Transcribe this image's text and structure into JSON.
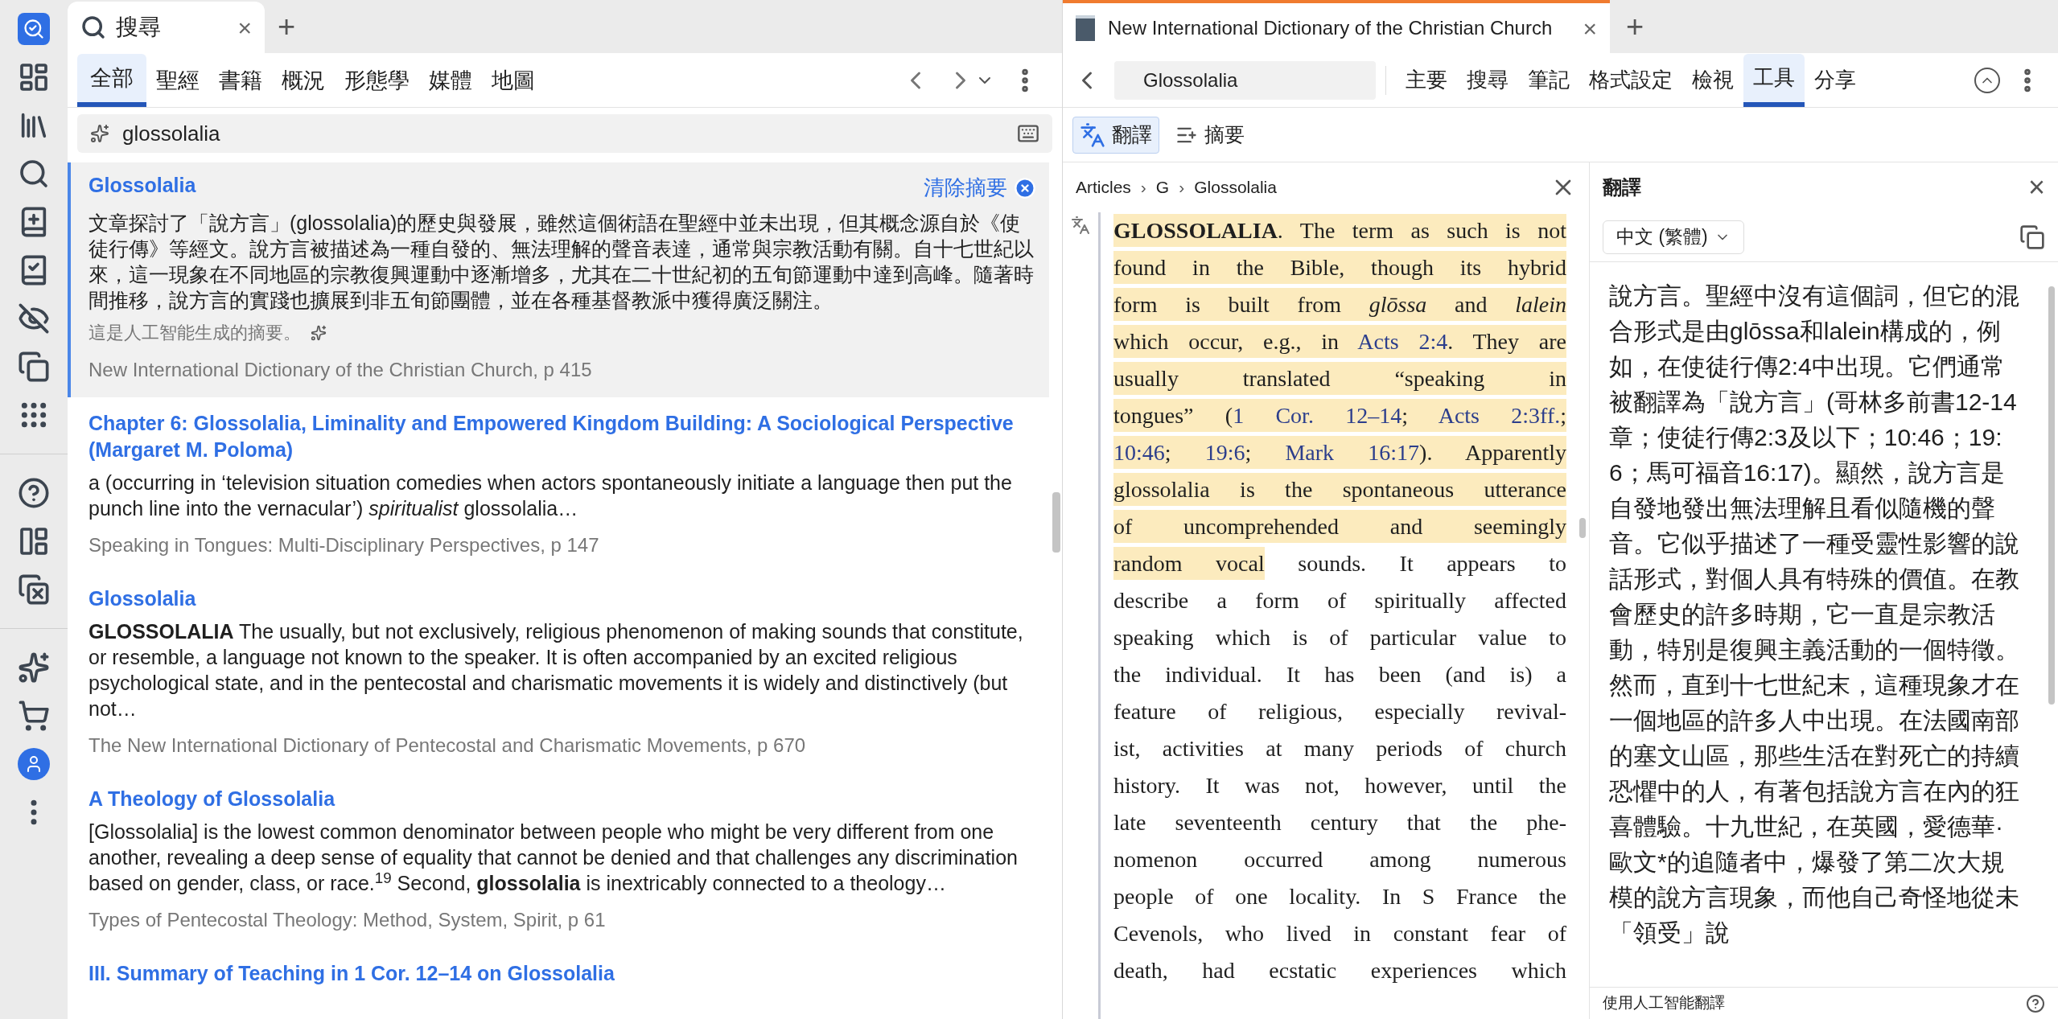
{
  "left_tab": {
    "title": "搜尋",
    "close": "×",
    "add": "+"
  },
  "search_tabs": [
    {
      "label": "全部",
      "selected": true
    },
    {
      "label": "聖經",
      "selected": false
    },
    {
      "label": "書籍",
      "selected": false
    },
    {
      "label": "概況",
      "selected": false
    },
    {
      "label": "形態學",
      "selected": false
    },
    {
      "label": "媒體",
      "selected": false
    },
    {
      "label": "地圖",
      "selected": false
    }
  ],
  "search": {
    "value": "glossolalia"
  },
  "results": [
    {
      "title": "Glossolalia",
      "selected": true,
      "clear_label": "清除摘要",
      "snippet": "文章探討了「說方言」(glossolalia)的歷史與發展，雖然這個術語在聖經中並未出現，但其概念源自於《使徒行傳》等經文。說方言被描述為一種自發的、無法理解的聲音表達，通常與宗教活動有關。自十七世紀以來，這一現象在不同地區的宗教復興運動中逐漸增多，尤其在二十世紀初的五旬節運動中達到高峰。隨著時間推移，說方言的實踐也擴展到非五旬節團體，並在各種基督教派中獲得廣泛關注。",
      "ai_note": "這是人工智能生成的摘要。",
      "source": "New International Dictionary of the Christian Church, p 415"
    },
    {
      "title": "Chapter 6: Glossolalia, Liminality and Empowered Kingdom Building: A Sociological Perspective (Margaret M. Poloma)",
      "selected": false,
      "snippet": "a (occurring in ‘television situation comedies when actors spontaneously initiate a language then put the punch line into the vernacular’) *spiritualist* glossolalia…",
      "source": "Speaking in Tongues: Multi-Disciplinary Perspectives, p 147"
    },
    {
      "title": "Glossolalia",
      "selected": false,
      "snippet": "**GLOSSOLALIA** The usually, but not exclusively, religious phenomenon of making sounds that constitute, or resemble, a language not known to the speaker. It is often accompanied by an excited religious psychological state, and in the pentecostal and charismatic movements it is widely and distinctively (but not…",
      "source": "The New International Dictionary of Pentecostal and Charismatic Movements, p 670"
    },
    {
      "title": "A Theology of Glossolalia",
      "selected": false,
      "snippet": "[Glossolalia] is the lowest common denominator between people who might be very different from one another, revealing a deep sense of equality that cannot be denied and that challenges any discrimination based on gender, class, or race.$^{19}$ Second, **glossolalia** is inextricably connected to a theology…",
      "source": "Types of Pentecostal Theology: Method, System, Spirit, p 61"
    },
    {
      "title": "III. Summary of Teaching in 1 Cor. 12–14 on Glossolalia",
      "selected": false
    }
  ],
  "right_tab": {
    "title": "New International Dictionary of the Christian Church",
    "close": "×",
    "add": "+"
  },
  "reference": {
    "value": "Glossolalia"
  },
  "menu": [
    {
      "label": "主要",
      "selected": false
    },
    {
      "label": "搜尋",
      "selected": false
    },
    {
      "label": "筆記",
      "selected": false
    },
    {
      "label": "格式設定",
      "selected": false
    },
    {
      "label": "檢視",
      "selected": false
    },
    {
      "label": "工具",
      "selected": true
    },
    {
      "label": "分享",
      "selected": false
    }
  ],
  "tools": [
    {
      "label": "翻譯",
      "kind": "translate",
      "selected": true
    },
    {
      "label": "摘要",
      "kind": "summary",
      "selected": false
    }
  ],
  "breadcrumb": {
    "separator": "›",
    "items": [
      "Articles",
      "G",
      "Glossolalia"
    ]
  },
  "article": {
    "lines": [
      {
        "segments": [
          {
            "kind": "bold",
            "text": "GLOSSOLALIA",
            "highlighted": true
          },
          {
            "kind": "text",
            "text": ". The term as such is not",
            "highlighted": true
          }
        ]
      },
      {
        "segments": [
          {
            "kind": "text",
            "text": "found in the Bible, though its hybrid",
            "highlighted": true
          }
        ]
      },
      {
        "segments": [
          {
            "kind": "text",
            "text": "form is built from ",
            "highlighted": true
          },
          {
            "kind": "italic",
            "text": "glōssa",
            "highlighted": true
          },
          {
            "kind": "text",
            "text": " and ",
            "highlighted": true
          },
          {
            "kind": "italic",
            "text": "lalein",
            "highlighted": true
          }
        ]
      },
      {
        "segments": [
          {
            "kind": "text",
            "text": "which occur, e.g., in ",
            "highlighted": true
          },
          {
            "kind": "link",
            "text": "Acts 2:4",
            "highlighted": true
          },
          {
            "kind": "text",
            "text": ". They are",
            "highlighted": true
          }
        ]
      },
      {
        "segments": [
          {
            "kind": "text",
            "text": "usually translated “speaking in",
            "highlighted": true
          }
        ]
      },
      {
        "segments": [
          {
            "kind": "text",
            "text": "tongues” (",
            "highlighted": true
          },
          {
            "kind": "link",
            "text": "1 Cor. 12–14",
            "highlighted": true
          },
          {
            "kind": "text",
            "text": "; ",
            "highlighted": true
          },
          {
            "kind": "link",
            "text": "Acts 2:3ff.",
            "highlighted": true
          },
          {
            "kind": "text",
            "text": ";",
            "highlighted": true
          }
        ]
      },
      {
        "segments": [
          {
            "kind": "link",
            "text": "10:46",
            "highlighted": true
          },
          {
            "kind": "text",
            "text": "; ",
            "highlighted": true
          },
          {
            "kind": "link",
            "text": "19:6",
            "highlighted": true
          },
          {
            "kind": "text",
            "text": "; ",
            "highlighted": true
          },
          {
            "kind": "link",
            "text": "Mark 16:17",
            "highlighted": true
          },
          {
            "kind": "text",
            "text": "). Apparently",
            "highlighted": true
          }
        ]
      },
      {
        "segments": [
          {
            "kind": "text",
            "text": "glossolalia is the spontaneous utterance",
            "highlighted": true
          }
        ]
      },
      {
        "segments": [
          {
            "kind": "text",
            "text": "of uncomprehended and seemingly",
            "highlighted": true
          }
        ]
      },
      {
        "segments": [
          {
            "kind": "text",
            "text": "random vocal",
            "highlighted": true
          },
          {
            "kind": "text",
            "text": " sounds. It appears to",
            "highlighted": false
          }
        ]
      },
      {
        "segments": [
          {
            "kind": "text",
            "text": "describe a form of spiritually affected",
            "highlighted": false
          }
        ]
      },
      {
        "segments": [
          {
            "kind": "text",
            "text": "speaking which is of particular value to",
            "highlighted": false
          }
        ]
      },
      {
        "segments": [
          {
            "kind": "text",
            "text": "the individual. It has been (and is) a",
            "highlighted": false
          }
        ]
      },
      {
        "segments": [
          {
            "kind": "text",
            "text": "feature of religious, especially revival-",
            "highlighted": false
          }
        ]
      },
      {
        "segments": [
          {
            "kind": "text",
            "text": "ist, activities at many periods of church",
            "highlighted": false
          }
        ]
      },
      {
        "segments": [
          {
            "kind": "text",
            "text": "history. It was not, however, until the",
            "highlighted": false
          }
        ]
      },
      {
        "segments": [
          {
            "kind": "text",
            "text": "late seventeenth century that the phe-",
            "highlighted": false
          }
        ]
      },
      {
        "segments": [
          {
            "kind": "text",
            "text": "nomenon occurred among numerous",
            "highlighted": false
          }
        ]
      },
      {
        "segments": [
          {
            "kind": "text",
            "text": "people of one locality. In S France the",
            "highlighted": false
          }
        ]
      },
      {
        "segments": [
          {
            "kind": "text",
            "text": "Cevenols, who lived in constant fear of",
            "highlighted": false
          }
        ]
      },
      {
        "segments": [
          {
            "kind": "text",
            "text": "death, had ecstatic experiences which",
            "highlighted": false
          }
        ]
      }
    ]
  },
  "translation": {
    "title": "翻譯",
    "close": "×",
    "language": "中文 (繁體)",
    "text": "說方言。聖經中沒有這個詞，但它的混合形式是由glōssa和lalein構成的，例如，在使徒行傳2:4中出現。它們通常被翻譯為「說方言」(哥林多前書12-14章；使徒行傳2:3及以下；10:46；19:6；馬可福音16:17)。顯然，說方言是自發地發出無法理解且看似隨機的聲音。它似乎描述了一種受靈性影響的說話形式，對個人具有特殊的價值。在教會歷史的許多時期，它一直是宗教活動，特別是復興主義活動的一個特徵。然而，直到十七世紀末，這種現象才在一個地區的許多人中出現。在法國南部的塞文山區，那些生活在對死亡的持續恐懼中的人，有著包括說方言在內的狂喜體驗。十九世紀，在英國，愛德華·歐文*的追隨者中，爆發了第二次大規模的說方言現象，而他自己奇怪地從未「領受」說",
    "footer": "使用人工智能翻譯"
  }
}
